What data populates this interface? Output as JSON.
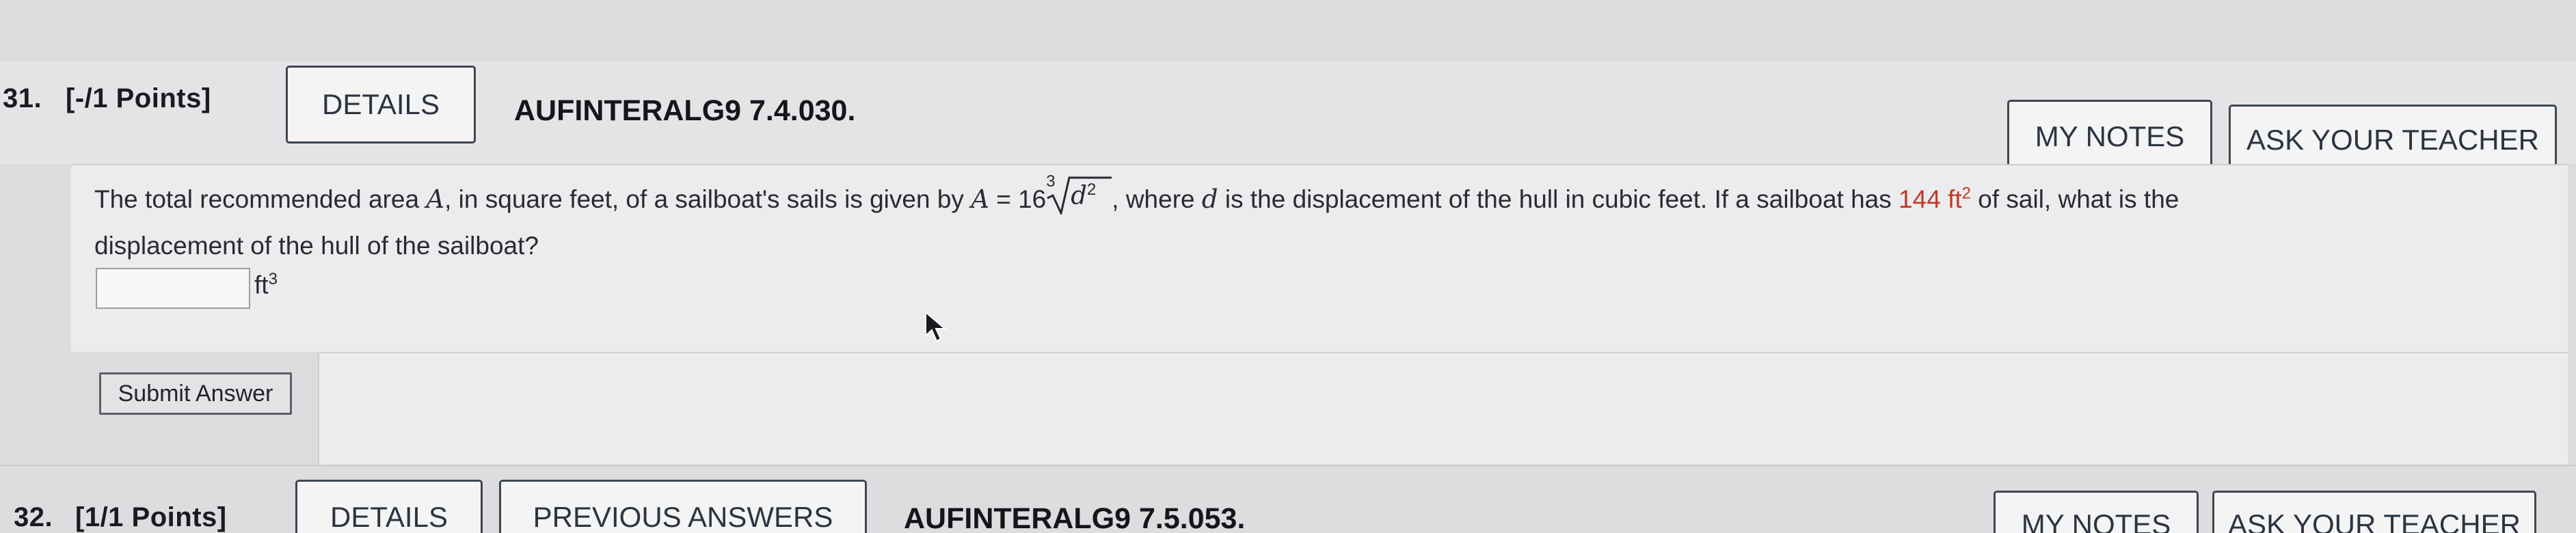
{
  "q31": {
    "number": "31.",
    "points": "[-/1 Points]",
    "details_label": "DETAILS",
    "code": "AUFINTERALG9 7.4.030.",
    "my_notes_label": "MY NOTES",
    "ask_teacher_label": "ASK YOUR TEACHER",
    "text_line1_a": "The total recommended area ",
    "var_A": "A",
    "text_line1_b": ", in square feet, of a sailboat's sails is given by ",
    "formula_A": "A",
    "formula_eq": " = 16",
    "formula_index": "3",
    "formula_radicand": "d",
    "formula_exp": "2",
    "text_line1_c": ",  where ",
    "var_d": "d",
    "text_line1_d": " is the displacement of the hull in cubic feet. If a sailboat has ",
    "given_value": "144",
    "given_unit": "ft",
    "given_exp": "2",
    "text_line1_e": " of sail, what is the",
    "text_line2": "displacement of the hull of the sailboat?",
    "answer_value": "",
    "answer_unit": "ft",
    "answer_unit_exp": "3",
    "submit_label": "Submit Answer"
  },
  "q32": {
    "number": "32.",
    "points": "[1/1 Points]",
    "details_label": "DETAILS",
    "previous_answers_label": "PREVIOUS ANSWERS",
    "code": "AUFINTERALG9 7.5.053.",
    "my_notes_label": "MY NOTES",
    "ask_teacher_label": "ASK YOUR TEACHER"
  },
  "colors": {
    "highlight": "#c0392b",
    "button_border": "#3f4750",
    "background": "#dcdcde"
  },
  "icons": {
    "cursor": "mouse-pointer-icon",
    "radical": "cube-root-radical-icon"
  }
}
